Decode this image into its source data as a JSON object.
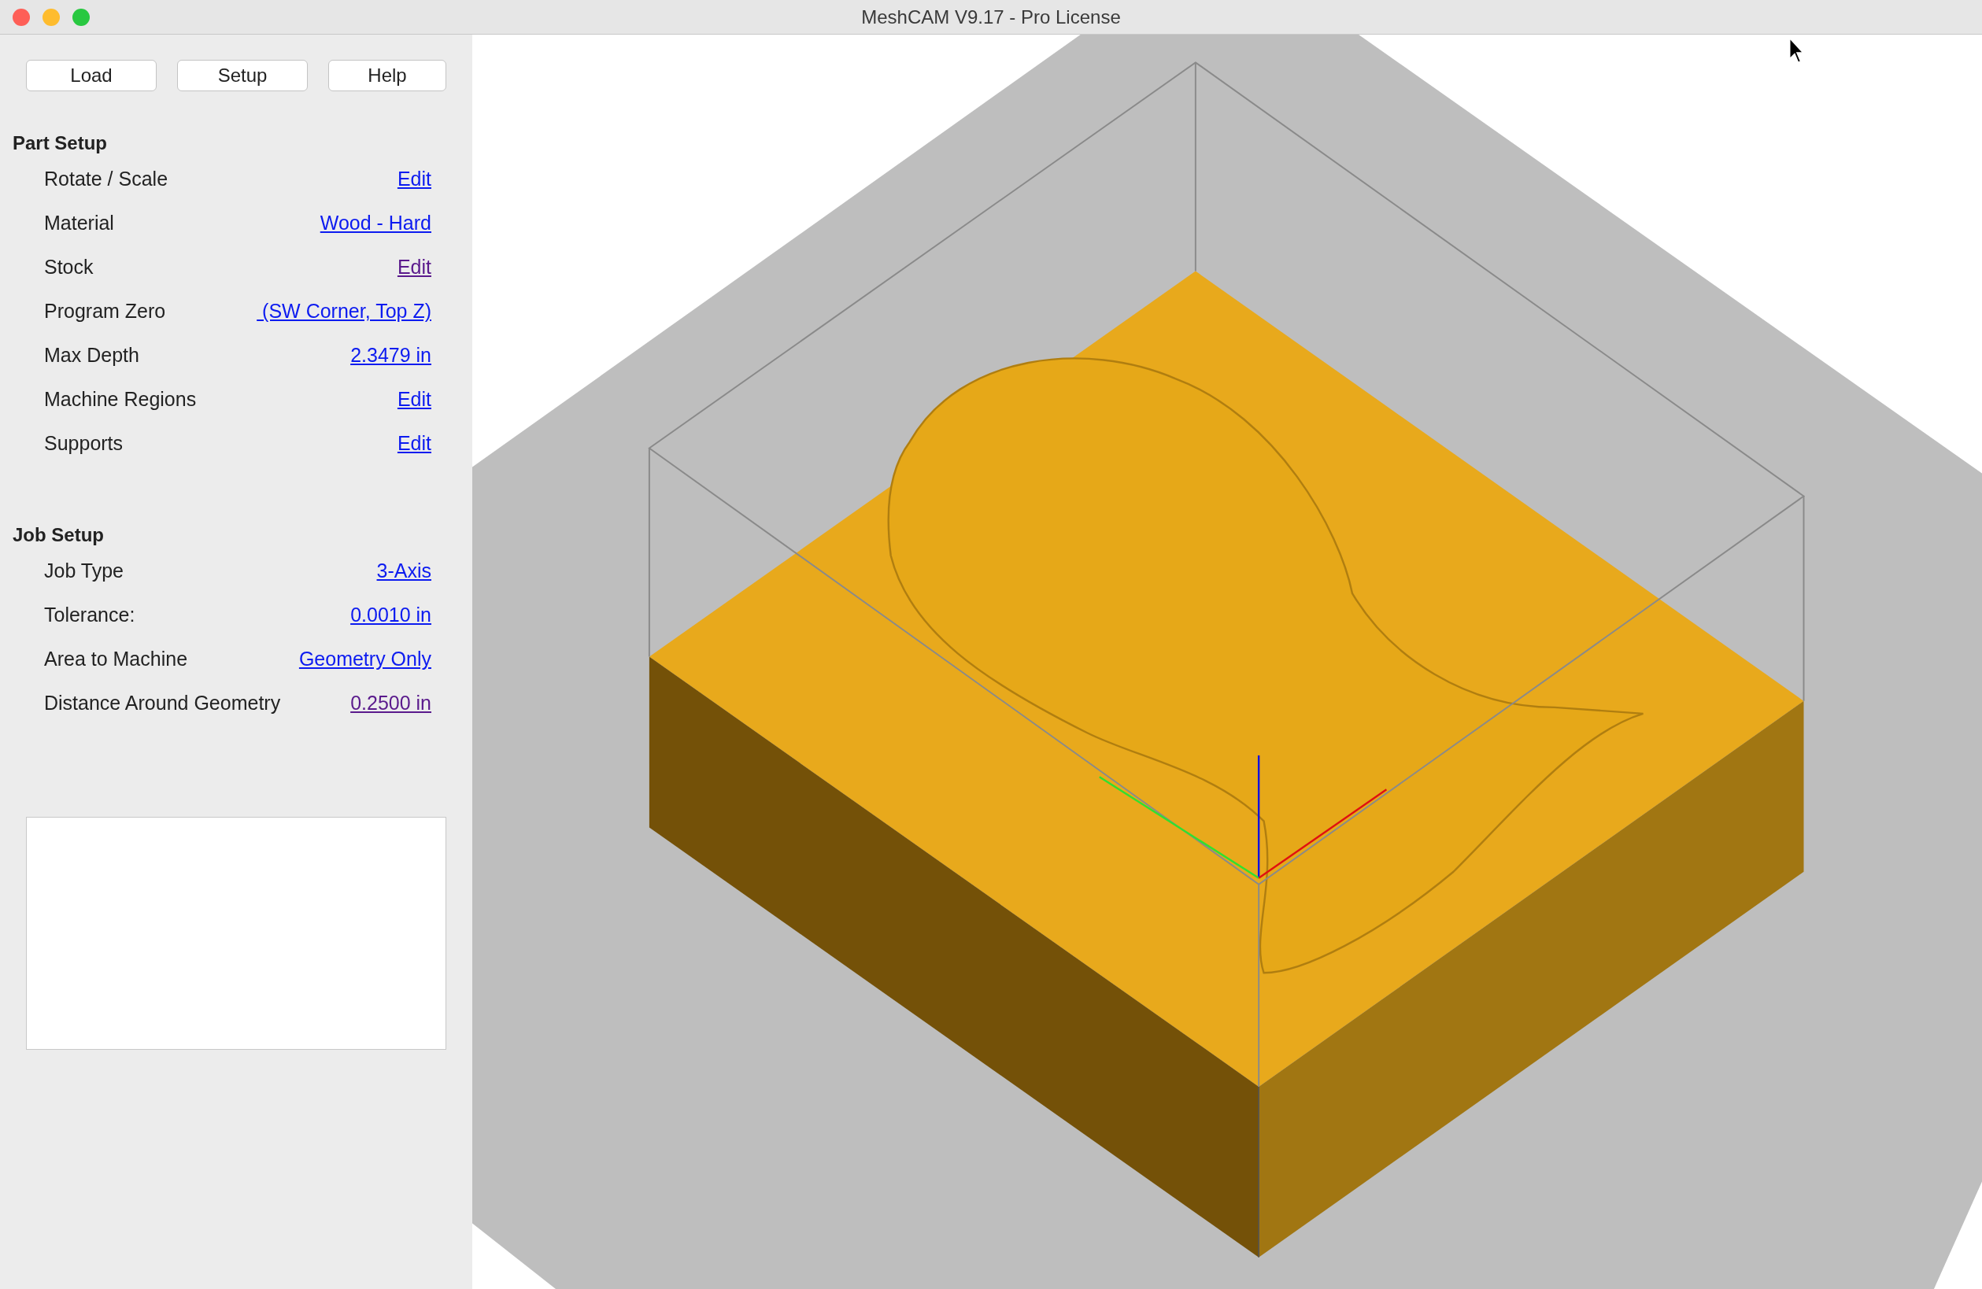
{
  "window": {
    "title": "MeshCAM V9.17 - Pro License"
  },
  "toolbar": [
    "Load",
    "Setup",
    "Help"
  ],
  "sections": [
    {
      "title": "Part Setup",
      "rows": [
        {
          "label": "Rotate / Scale",
          "value": "Edit",
          "visited": false
        },
        {
          "label": "Material",
          "value": "Wood - Hard",
          "visited": false
        },
        {
          "label": "Stock",
          "value": "Edit",
          "visited": true
        },
        {
          "label": "Program Zero",
          "value": " (SW Corner, Top Z)",
          "visited": false
        },
        {
          "label": "Max Depth",
          "value": "2.3479 in",
          "visited": false
        },
        {
          "label": "Machine Regions",
          "value": "Edit",
          "visited": false
        },
        {
          "label": "Supports",
          "value": "Edit",
          "visited": false
        }
      ]
    },
    {
      "title": "Job Setup",
      "rows": [
        {
          "label": "Job Type",
          "value": "3-Axis",
          "visited": false
        },
        {
          "label": "Tolerance:",
          "value": "0.0010 in",
          "visited": false
        },
        {
          "label": "Area to Machine",
          "value": "Geometry Only",
          "visited": false
        },
        {
          "label": "Distance Around Geometry",
          "value": "0.2500 in",
          "visited": true
        }
      ]
    }
  ]
}
